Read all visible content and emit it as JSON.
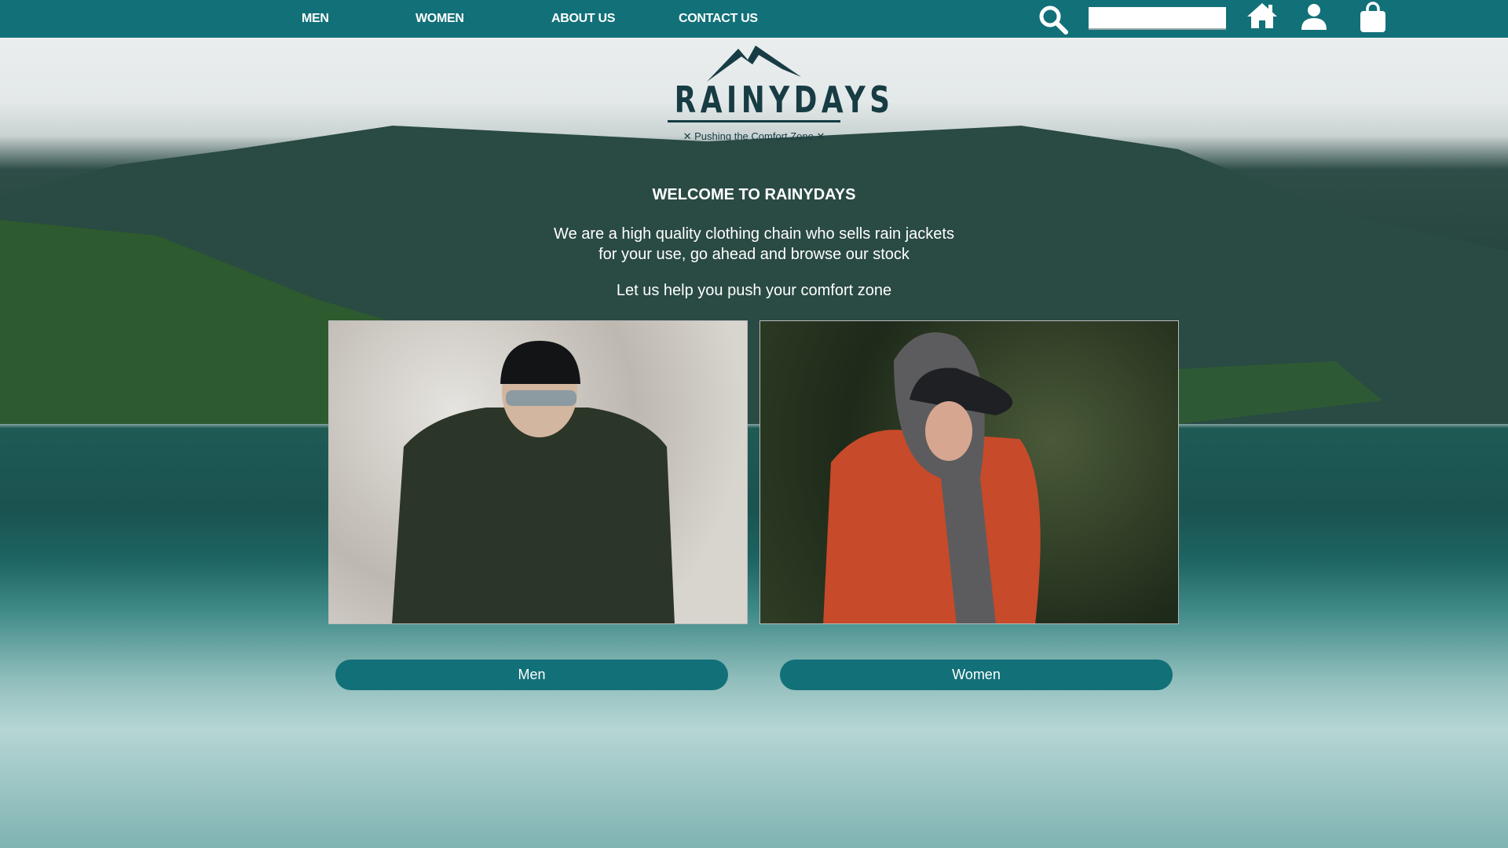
{
  "nav": {
    "items": [
      {
        "label": "MEN"
      },
      {
        "label": "WOMEN"
      },
      {
        "label": "ABOUT US"
      },
      {
        "label": "CONTACT US"
      }
    ],
    "search_value": "",
    "icons": [
      "search-icon",
      "home-icon",
      "user-icon",
      "shopping-bag-icon"
    ]
  },
  "logo": {
    "name": "RAINYDAYS",
    "tagline": "✕ Pushing the Comfort Zone ✕"
  },
  "hero": {
    "title": "WELCOME TO RAINYDAYS",
    "description": "We are a high quality clothing chain who sells rain jackets for your use, go ahead and browse our stock",
    "slogan": "Let us help you push your comfort zone"
  },
  "categories": [
    {
      "label": "Men"
    },
    {
      "label": "Women"
    }
  ],
  "colors": {
    "primary": "#127078",
    "logo": "#173c44"
  }
}
